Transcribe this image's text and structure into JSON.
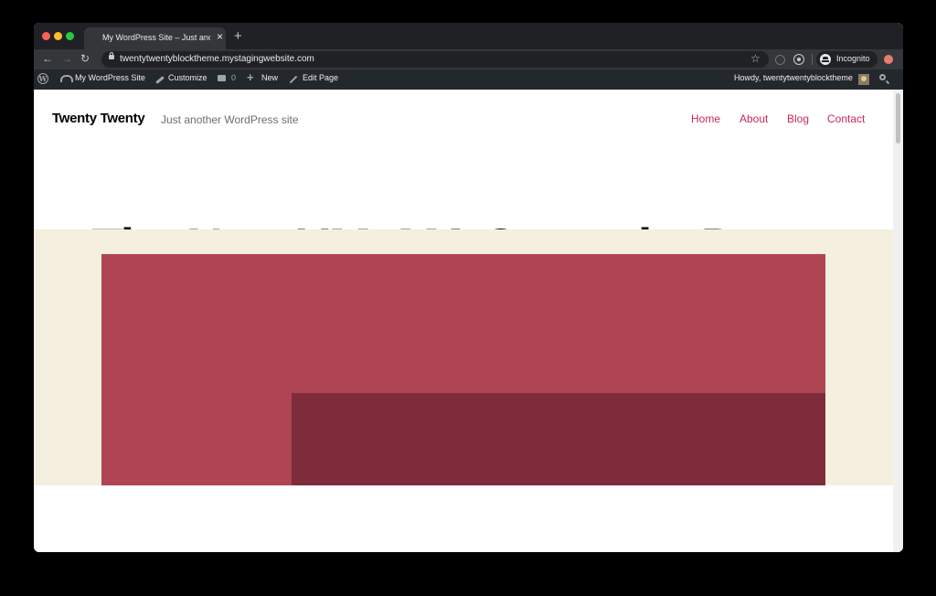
{
  "browser": {
    "tab_title": "My WordPress Site – Just another",
    "tab_close": "×",
    "new_tab": "+",
    "url": "twentytwentyblocktheme.mystagingwebsite.com",
    "incognito_label": "Incognito",
    "icons": [
      "back-icon",
      "forward-icon",
      "reload-icon",
      "lock-icon",
      "star-icon",
      "extension-icon",
      "incognito-icon"
    ]
  },
  "admin_bar": {
    "site_name": "My WordPress Site",
    "customize": "Customize",
    "comments_count": "0",
    "new": "New",
    "edit_page": "Edit Page",
    "howdy": "Howdy, twentytwentyblocktheme"
  },
  "site": {
    "title": "Twenty Twenty",
    "description": "Just another WordPress site",
    "nav": [
      "Home",
      "About",
      "Blog",
      "Contact"
    ]
  },
  "page": {
    "heading": "The New UMoMA Opens its Doors"
  },
  "colors": {
    "accent": "#cd2653",
    "beige": "#f5efe0",
    "red_block": "#af4453",
    "dark_red_block": "#7e2c3b",
    "admin_bar": "#23282d"
  }
}
